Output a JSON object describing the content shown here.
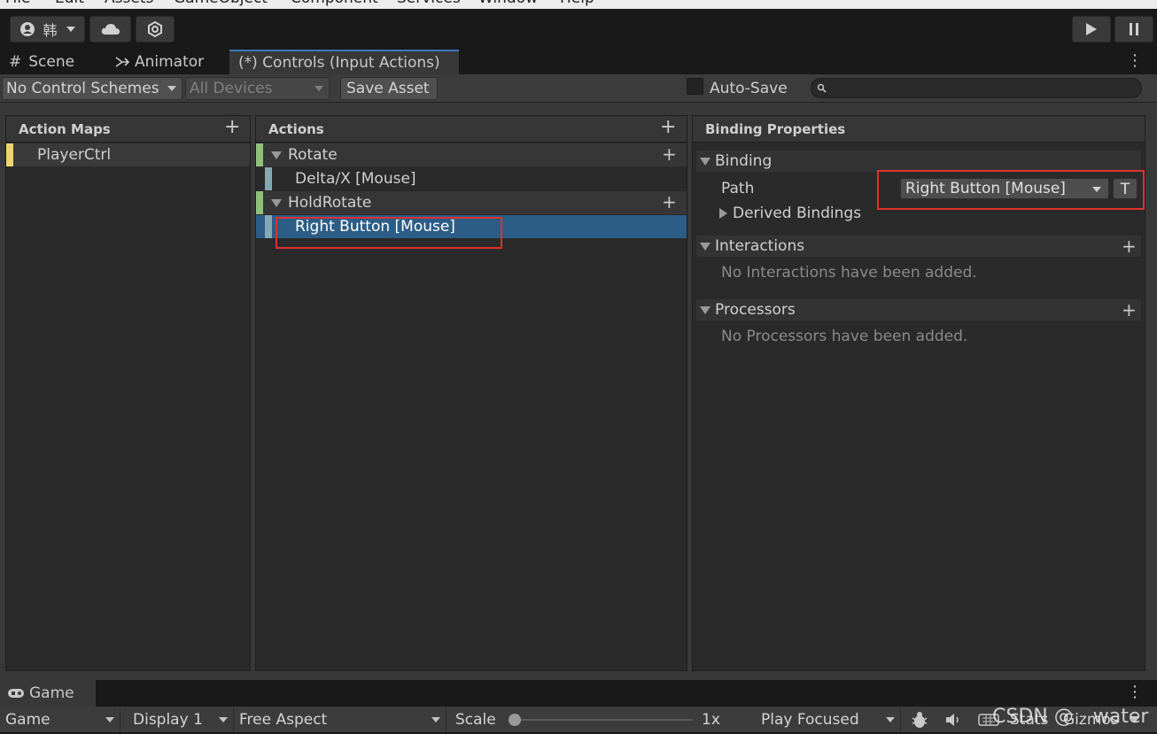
{
  "menu": [
    "File",
    "Edit",
    "Assets",
    "GameObject",
    "Component",
    "Services",
    "Window",
    "Help"
  ],
  "toolbar": {
    "account_label": "韩",
    "account_icon": "account-icon",
    "cloud_icon": "cloud-icon",
    "collab_icon": "collab-icon",
    "play_icon": "play-icon",
    "pause_icon": "pause-icon"
  },
  "tabs": [
    {
      "label": "Scene",
      "icon": "grid-icon"
    },
    {
      "label": "Animator",
      "icon": "animator-icon"
    },
    {
      "label": "(*) Controls (Input Actions)",
      "active": true
    }
  ],
  "asset_toolbar": {
    "control_schemes": "No Control Schemes",
    "devices": "All Devices",
    "save_asset": "Save Asset",
    "auto_save": "Auto-Save",
    "auto_save_checked": false,
    "search_value": ""
  },
  "action_maps": {
    "title": "Action Maps",
    "items": [
      {
        "label": "PlayerCtrl",
        "color": "#f0d273"
      }
    ]
  },
  "actions": {
    "title": "Actions",
    "items": [
      {
        "label": "Rotate",
        "type": "action",
        "color": "#8fc07a"
      },
      {
        "label": "Delta/X [Mouse]",
        "type": "binding",
        "color": "#84a9b3"
      },
      {
        "label": "HoldRotate",
        "type": "action",
        "color": "#8fc07a"
      },
      {
        "label": "Right Button [Mouse]",
        "type": "binding",
        "selected": true,
        "color": "#84a9b3"
      }
    ]
  },
  "binding_properties": {
    "title": "Binding Properties",
    "binding_section": "Binding",
    "path_label": "Path",
    "path_value": "Right Button [Mouse]",
    "t_button": "T",
    "derived_bindings": "Derived Bindings",
    "interactions_section": "Interactions",
    "interactions_empty": "No Interactions have been added.",
    "processors_section": "Processors",
    "processors_empty": "No Processors have been added."
  },
  "game": {
    "tab": "Game",
    "view_mode": "Game",
    "display": "Display 1",
    "aspect": "Free Aspect",
    "scale_label": "Scale",
    "scale_value": "1x",
    "play_mode": "Play Focused",
    "stats": "Stats",
    "gizmos": "Gizmos"
  },
  "watermark": "CSDN @　water",
  "colors": {
    "selection": "#2c5d87",
    "highlight_border": "#e03030",
    "tab_accent": "#3a79bb"
  }
}
